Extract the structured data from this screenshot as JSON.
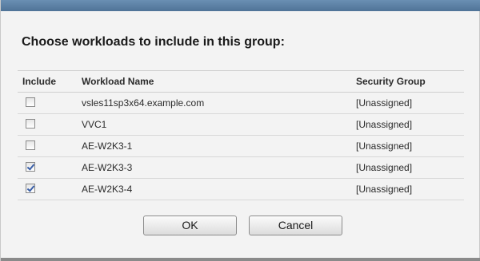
{
  "dialog": {
    "heading": "Choose workloads to include in this group:"
  },
  "grid": {
    "headers": {
      "include": "Include",
      "name": "Workload Name",
      "security_group": "Security Group"
    },
    "rows": [
      {
        "checked": false,
        "name": "vsles11sp3x64.example.com",
        "security_group": "[Unassigned]"
      },
      {
        "checked": false,
        "name": "VVC1",
        "security_group": "[Unassigned]"
      },
      {
        "checked": false,
        "name": "AE-W2K3-1",
        "security_group": "[Unassigned]"
      },
      {
        "checked": true,
        "name": "AE-W2K3-3",
        "security_group": "[Unassigned]"
      },
      {
        "checked": true,
        "name": "AE-W2K3-4",
        "security_group": "[Unassigned]"
      }
    ]
  },
  "buttons": {
    "ok": "OK",
    "cancel": "Cancel"
  },
  "colors": {
    "title_bar": "#5b80a5",
    "check_mark": "#3a5fa8"
  }
}
